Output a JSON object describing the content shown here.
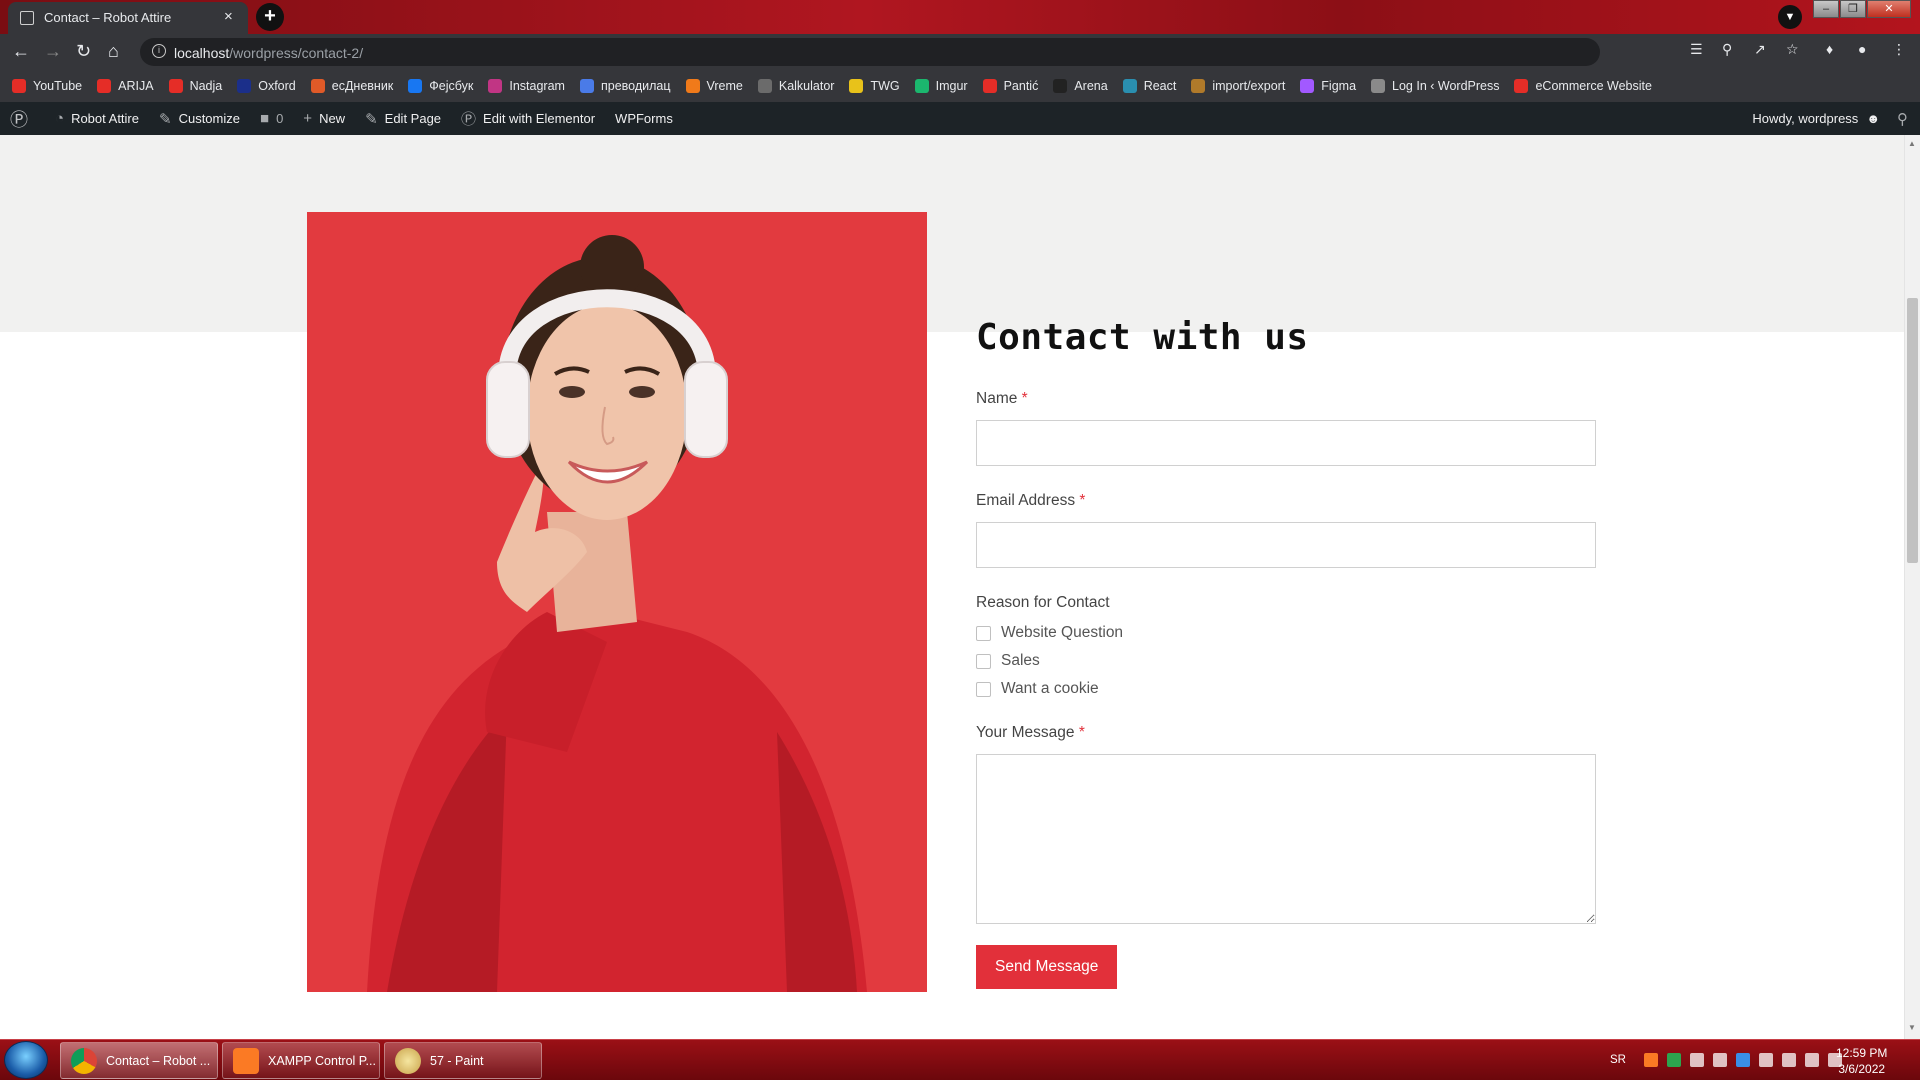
{
  "browser": {
    "tab_title": "Contact – Robot Attire",
    "tab_close": "×",
    "new_tab": "+",
    "url_host": "localhost",
    "url_path": "/wordpress/contact-2/",
    "bookmarks": [
      {
        "label": "YouTube",
        "color": "#e52d27",
        "icon": "youtube-icon"
      },
      {
        "label": "ARIJA",
        "color": "#e52d27",
        "icon": "youtube-icon"
      },
      {
        "label": "Nadja",
        "color": "#e52d27",
        "icon": "youtube-icon"
      },
      {
        "label": "Oxford",
        "color": "#1b2f8a",
        "icon": "oxford-icon"
      },
      {
        "label": "есДневник",
        "color": "#e05a28",
        "icon": "esdnevnik-icon"
      },
      {
        "label": "Фејсбук",
        "color": "#1877f2",
        "icon": "facebook-icon"
      },
      {
        "label": "Instagram",
        "color": "#c13584",
        "icon": "instagram-icon"
      },
      {
        "label": "преводилац",
        "color": "#4a7be8",
        "icon": "translator-icon"
      },
      {
        "label": "Vreme",
        "color": "#f07a1a",
        "icon": "weather-icon"
      },
      {
        "label": "Kalkulator",
        "color": "#6b6b6b",
        "icon": "calculator-icon"
      },
      {
        "label": "TWG",
        "color": "#e8c21a",
        "icon": "twg-icon"
      },
      {
        "label": "Imgur",
        "color": "#1bb76e",
        "icon": "imgur-icon"
      },
      {
        "label": "Pantić",
        "color": "#e52d27",
        "icon": "youtube-icon"
      },
      {
        "label": "Arena",
        "color": "#222222",
        "icon": "arena-icon"
      },
      {
        "label": "React",
        "color": "#2a8fb0",
        "icon": "react-icon"
      },
      {
        "label": "import/export",
        "color": "#b07a2a",
        "icon": "import-export-icon"
      },
      {
        "label": "Figma",
        "color": "#a259ff",
        "icon": "figma-icon"
      },
      {
        "label": "Log In ‹ WordPress",
        "color": "#8a8a8a",
        "icon": "wordpress-page-icon"
      },
      {
        "label": "eCommerce Website",
        "color": "#e52d27",
        "icon": "youtube-icon"
      }
    ]
  },
  "adminbar": {
    "site_name": "Robot Attire",
    "customize": "Customize",
    "comments_count": "0",
    "new": "New",
    "edit_page": "Edit Page",
    "elementor": "Edit with Elementor",
    "wpforms": "WPForms",
    "howdy": "Howdy, wordpress"
  },
  "page": {
    "heading": "Contact with us",
    "name_label": "Name",
    "email_label": "Email Address",
    "required_mark": "*",
    "reason_label": "Reason for Contact",
    "reasons": [
      "Website Question",
      "Sales",
      "Want a cookie"
    ],
    "message_label": "Your Message",
    "send_button": "Send Message",
    "photo_bg": "#e23a3f",
    "accent": "#e2303a"
  },
  "taskbar": {
    "tasks": [
      "Contact – Robot ...",
      "XAMPP Control P...",
      "57 - Paint"
    ],
    "lang": "SR",
    "time": "12:59 PM",
    "date": "3/6/2022"
  }
}
